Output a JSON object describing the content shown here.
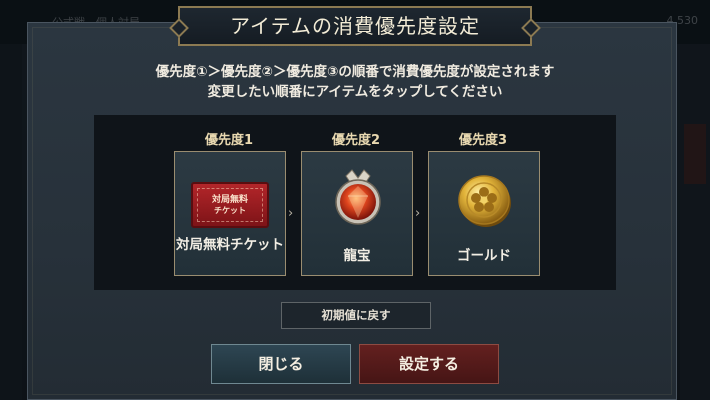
{
  "background": {
    "top_left_text": "公式戦　個人対局",
    "top_right_text": "4,530"
  },
  "dialog": {
    "title": "アイテムの消費優先度設定",
    "description_line1": "優先度①＞優先度②＞優先度③の順番で消費優先度が設定されます",
    "description_line2": "変更したい順番にアイテムをタップしてください",
    "priorities": [
      {
        "label": "優先度1",
        "item_name": "対局無料チケット",
        "icon": "ticket-icon",
        "icon_text_line1": "対局無料",
        "icon_text_line2": "チケット"
      },
      {
        "label": "優先度2",
        "item_name": "龍宝",
        "icon": "dragon-gem-icon"
      },
      {
        "label": "優先度3",
        "item_name": "ゴールド",
        "icon": "gold-coin-icon"
      }
    ],
    "separator_glyph": "›",
    "reset_button": "初期値に戻す",
    "close_button": "閉じる",
    "confirm_button": "設定する"
  },
  "colors": {
    "dialog_bg": "#27313a",
    "gold_border": "#8c7a52",
    "close_button": "#2e4653",
    "confirm_button": "#63201f"
  }
}
